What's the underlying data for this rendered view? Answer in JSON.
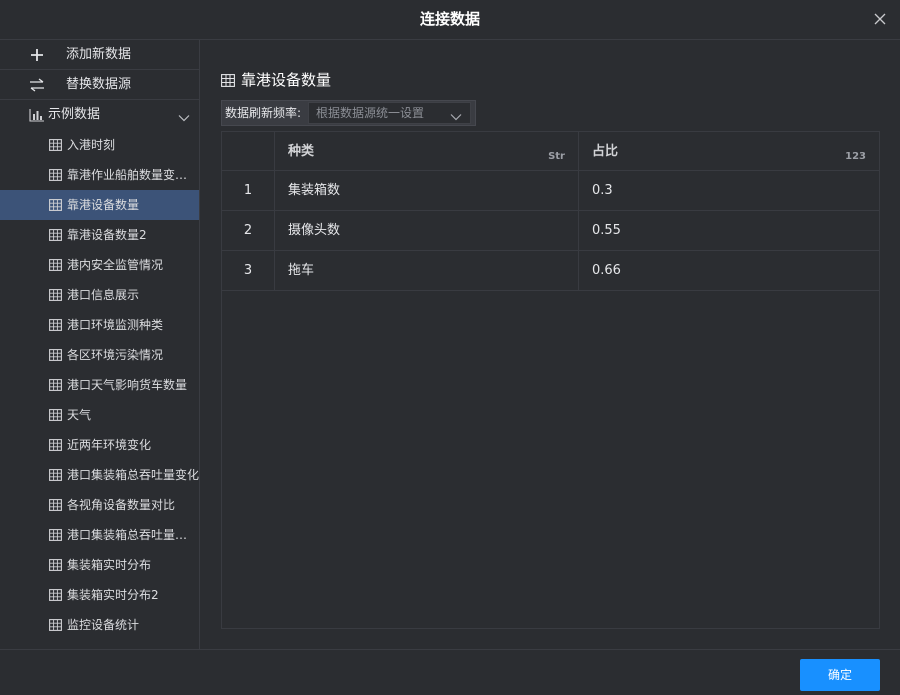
{
  "dialog": {
    "title": "连接数据",
    "close_icon": "close-icon"
  },
  "sidebar": {
    "actions": [
      {
        "label": "添加新数据",
        "icon": "plus-icon"
      },
      {
        "label": "替换数据源",
        "icon": "swap-icon"
      }
    ],
    "group": {
      "label": "示例数据",
      "icon": "bar-chart-icon",
      "expanded": true
    },
    "items": [
      {
        "label": "入港时刻"
      },
      {
        "label": "靠港作业船舶数量变化情况"
      },
      {
        "label": "靠港设备数量",
        "selected": true
      },
      {
        "label": "靠港设备数量2"
      },
      {
        "label": "港内安全监管情况"
      },
      {
        "label": "港口信息展示"
      },
      {
        "label": "港口环境监测种类"
      },
      {
        "label": "各区环境污染情况"
      },
      {
        "label": "港口天气影响货车数量"
      },
      {
        "label": "天气"
      },
      {
        "label": "近两年环境变化"
      },
      {
        "label": "港口集装箱总吞吐量变化"
      },
      {
        "label": "各视角设备数量对比"
      },
      {
        "label": "港口集装箱总吞吐量变化情况"
      },
      {
        "label": "集装箱实时分布"
      },
      {
        "label": "集装箱实时分布2"
      },
      {
        "label": "监控设备统计"
      }
    ]
  },
  "main": {
    "title": "靠港设备数量",
    "refresh": {
      "label": "数据刷新频率:",
      "value": "根据数据源统一设置"
    },
    "table": {
      "columns": [
        {
          "name": "",
          "type": ""
        },
        {
          "name": "种类",
          "type": "Str"
        },
        {
          "name": "占比",
          "type": "123"
        }
      ],
      "rows": [
        [
          "1",
          "集装箱数",
          "0.3"
        ],
        [
          "2",
          "摄像头数",
          "0.55"
        ],
        [
          "3",
          "拖车",
          "0.66"
        ]
      ]
    }
  },
  "footer": {
    "ok_label": "确定"
  },
  "colors": {
    "accent": "#1890ff",
    "selected": "#3c5378",
    "background": "#2b2d31"
  }
}
